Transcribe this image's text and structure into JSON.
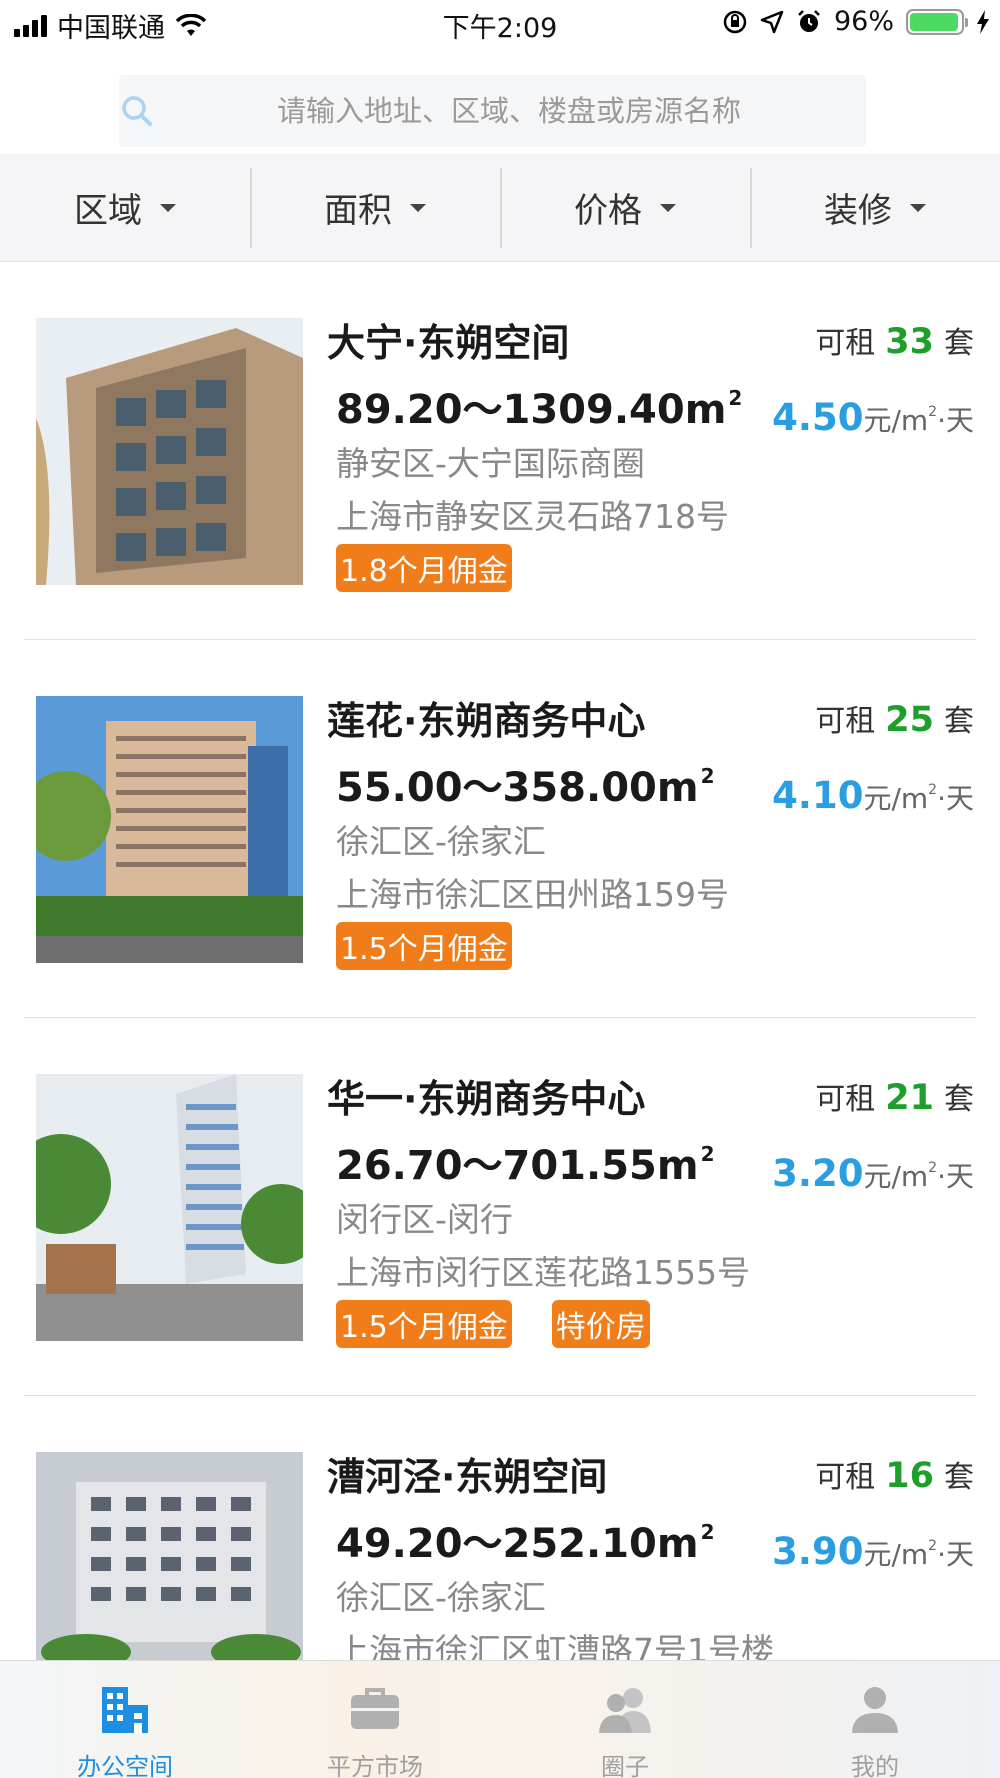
{
  "status_bar": {
    "carrier": "中国联通",
    "time": "下午2:09",
    "battery": "96%",
    "battery_level": 0.96
  },
  "search": {
    "placeholder": "请输入地址、区域、楼盘或房源名称"
  },
  "filters": [
    {
      "label": "区域"
    },
    {
      "label": "面积"
    },
    {
      "label": "价格"
    },
    {
      "label": "装修"
    }
  ],
  "listings": [
    {
      "title": "大宁·东朔空间",
      "avail_prefix": "可租",
      "avail_count": "33",
      "avail_unit": "套",
      "area": "89.20～1309.40m",
      "area_sup": "2",
      "price": "4.50",
      "price_unit_a": "元/m",
      "price_unit_sup": "2",
      "price_unit_b": "·天",
      "district": "静安区-大宁国际商圈",
      "address": "上海市静安区灵石路718号",
      "tags": [
        "1.8个月佣金"
      ]
    },
    {
      "title": "莲花·东朔商务中心",
      "avail_prefix": "可租",
      "avail_count": "25",
      "avail_unit": "套",
      "area": "55.00～358.00m",
      "area_sup": "2",
      "price": "4.10",
      "price_unit_a": "元/m",
      "price_unit_sup": "2",
      "price_unit_b": "·天",
      "district": "徐汇区-徐家汇",
      "address": "上海市徐汇区田州路159号",
      "tags": [
        "1.5个月佣金"
      ]
    },
    {
      "title": "华一·东朔商务中心",
      "avail_prefix": "可租",
      "avail_count": "21",
      "avail_unit": "套",
      "area": "26.70～701.55m",
      "area_sup": "2",
      "price": "3.20",
      "price_unit_a": "元/m",
      "price_unit_sup": "2",
      "price_unit_b": "·天",
      "district": "闵行区-闵行",
      "address": "上海市闵行区莲花路1555号",
      "tags": [
        "1.5个月佣金",
        "特价房"
      ]
    },
    {
      "title": "漕河泾·东朔空间",
      "avail_prefix": "可租",
      "avail_count": "16",
      "avail_unit": "套",
      "area": "49.20～252.10m",
      "area_sup": "2",
      "price": "3.90",
      "price_unit_a": "元/m",
      "price_unit_sup": "2",
      "price_unit_b": "·天",
      "district": "徐汇区-徐家汇",
      "address": "上海市徐汇区虹漕路7号1号楼",
      "tags": []
    }
  ],
  "tabs": [
    {
      "label": "办公空间",
      "icon": "office-building-icon",
      "active": true
    },
    {
      "label": "平方市场",
      "icon": "briefcase-icon",
      "active": false
    },
    {
      "label": "圈子",
      "icon": "group-icon",
      "active": false
    },
    {
      "label": "我的",
      "icon": "person-icon",
      "active": false
    }
  ],
  "colors": {
    "accent_blue": "#1e8fe0",
    "price_blue": "#2a9ee0",
    "avail_green": "#1e9e2a",
    "tag_orange": "#f07c1a"
  }
}
